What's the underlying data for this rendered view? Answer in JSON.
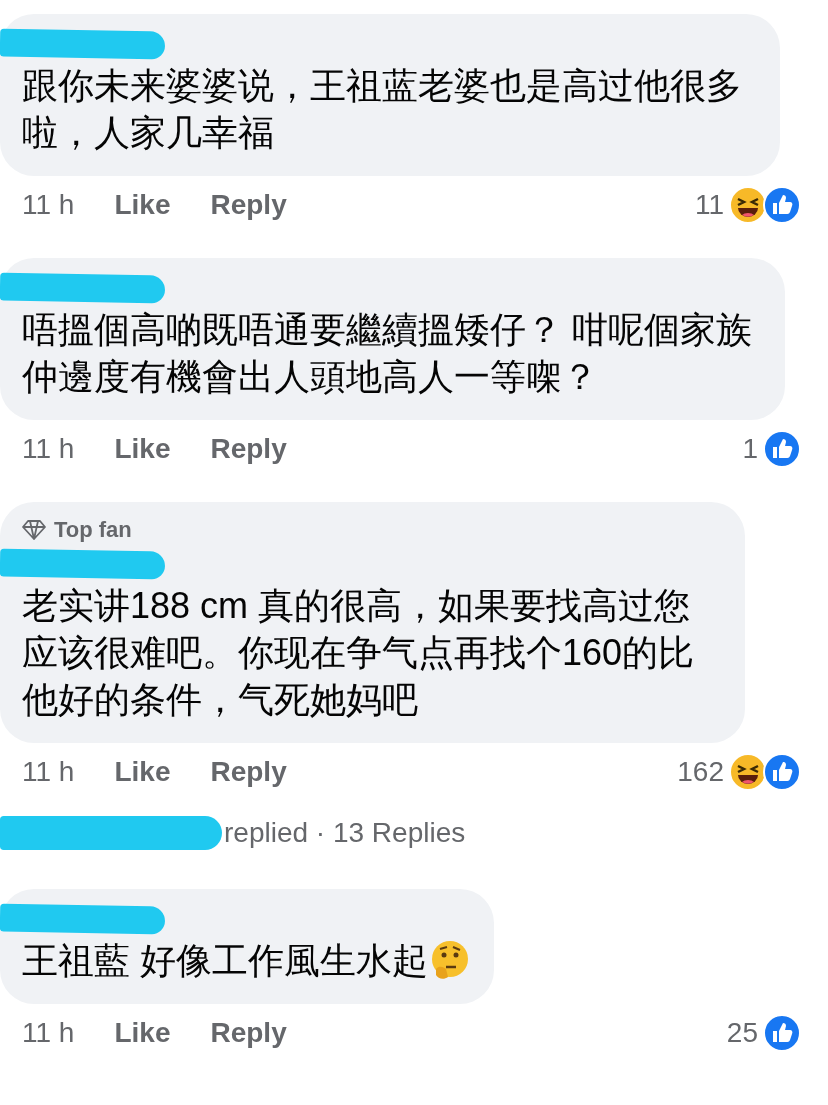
{
  "comments": [
    {
      "text": "跟你未来婆婆说，王祖蓝老婆也是高过他很多啦，人家几幸福",
      "time": "11 h",
      "actions": [
        "Like",
        "Reply"
      ],
      "reaction_count": "11",
      "reactions": [
        {
          "kind": "haha"
        },
        {
          "kind": "like"
        }
      ]
    },
    {
      "text": "唔搵個高啲既唔通要繼續搵矮仔？ 咁呢個家族仲邊度有機會出人頭地高人一等㗎？",
      "time": "11 h",
      "actions": [
        "Like",
        "Reply"
      ],
      "reaction_count": "1",
      "reactions": [
        {
          "kind": "like"
        }
      ]
    },
    {
      "badge": "Top fan",
      "text": "老实讲188 cm  真的很高，如果要找高过您应该很难吧。你现在争气点再找个160的比他好的条件，气死她妈吧",
      "time": "11 h",
      "actions": [
        "Like",
        "Reply"
      ],
      "reaction_count": "162",
      "reactions": [
        {
          "kind": "haha"
        },
        {
          "kind": "like"
        }
      ],
      "replies_summary": "replied · 13 Replies"
    },
    {
      "text": "王祖藍 好像工作風生水起",
      "trailing_emoji": {
        "kind": "thinking"
      },
      "time": "11 h",
      "actions": [
        "Like",
        "Reply"
      ],
      "reaction_count": "25",
      "reactions": [
        {
          "kind": "like"
        }
      ]
    }
  ]
}
